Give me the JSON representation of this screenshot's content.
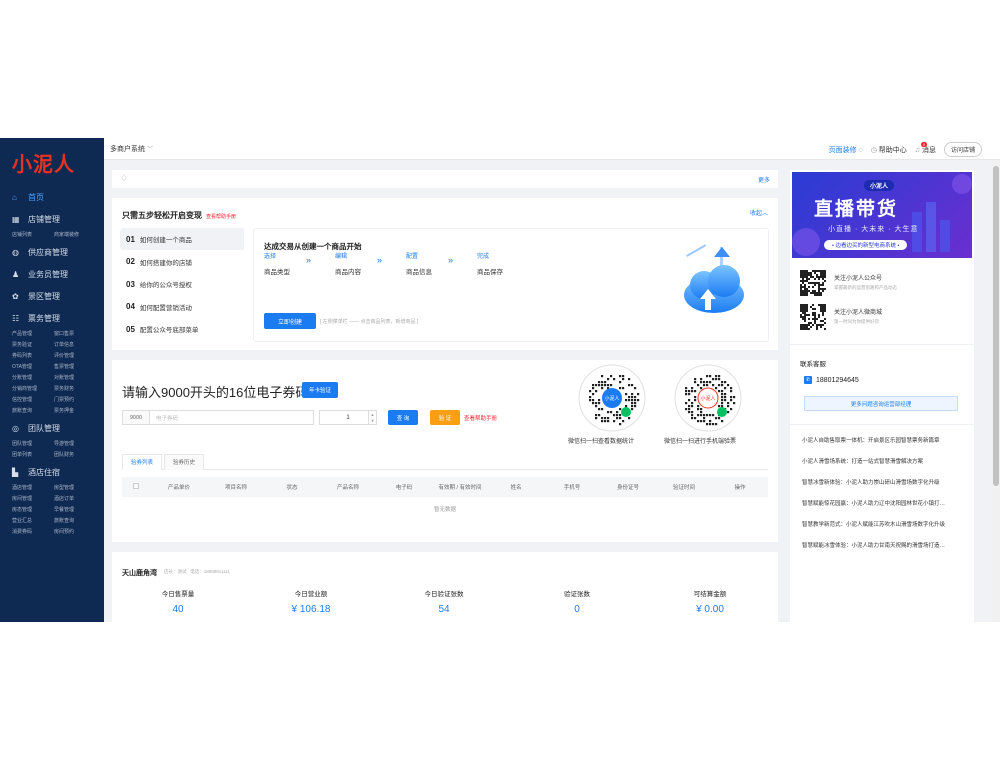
{
  "sidebar": {
    "logo_text": "小泥人",
    "groups": [
      {
        "icon": "home-icon",
        "glyph": "⌂",
        "label": "首页",
        "active": true,
        "subs": []
      },
      {
        "icon": "store-icon",
        "glyph": "▦",
        "label": "店铺管理",
        "active": false,
        "subs": [
          "店铺列表",
          "商家端装修"
        ]
      },
      {
        "icon": "supplier-icon",
        "glyph": "◍",
        "label": "供应商管理",
        "active": false,
        "subs": []
      },
      {
        "icon": "salesman-icon",
        "glyph": "♟",
        "label": "业务员管理",
        "active": false,
        "subs": []
      },
      {
        "icon": "scenic-icon",
        "glyph": "✿",
        "label": "景区管理",
        "active": false,
        "subs": []
      },
      {
        "icon": "ticket-icon",
        "glyph": "☷",
        "label": "票务管理",
        "active": false,
        "subs": [
          "产品管理",
          "窗口售票",
          "票务验证",
          "订单信息",
          "券码列表",
          "评价管理",
          "OTA管理",
          "售票管理",
          "分账管理",
          "对账管理",
          "分销商管理",
          "票务财务",
          "信控管理",
          "门票预约",
          "旅账查询",
          "票务押金"
        ]
      },
      {
        "icon": "team-icon",
        "glyph": "◎",
        "label": "团队管理",
        "active": false,
        "subs": [
          "团队管理",
          "导游管理",
          "团单列表",
          "团队财务"
        ]
      },
      {
        "icon": "hotel-icon",
        "glyph": "▙",
        "label": "酒店住宿",
        "active": false,
        "subs": [
          "酒店管理",
          "房型管理",
          "房间管理",
          "酒店订单",
          "房态管理",
          "早餐管理",
          "营业汇总",
          "旅账查询",
          "消费券码",
          "房间预约"
        ]
      }
    ]
  },
  "topbar": {
    "system": "多商户系统",
    "page_design": "页面装修",
    "help": "帮助中心",
    "messages": "消息",
    "message_count": "0",
    "visit": "访问店铺"
  },
  "notice": {
    "more": "更多"
  },
  "steps": {
    "title": "只需五步轻松开启变现",
    "help": "查看帮助手册",
    "collapse": "收起",
    "items": [
      {
        "num": "01",
        "label": "如何创建一个商品"
      },
      {
        "num": "02",
        "label": "如何搭建你的店铺"
      },
      {
        "num": "03",
        "label": "给你的公众号授权"
      },
      {
        "num": "04",
        "label": "如何配置营销活动"
      },
      {
        "num": "05",
        "label": "配置公众号底部菜单"
      }
    ],
    "panel_title": "达成交易从创建一个商品开始",
    "stages": [
      {
        "label": "选择",
        "value": "商品类型"
      },
      {
        "label": "编辑",
        "value": "商品内容"
      },
      {
        "label": "配置",
        "value": "商品信息"
      },
      {
        "label": "完成",
        "value": "商品保存"
      }
    ],
    "create_button": "立即创建",
    "hint": "[ 左侧菜单栏 —— 点击商品列表，新增商品 ]"
  },
  "coupon": {
    "title": "请输入9000开头的16位电子券码",
    "year_card": "年卡验证",
    "prefix": "9000",
    "code_placeholder": "电子券码",
    "qty": "1",
    "query": "查 询",
    "verify": "验 证",
    "help": "查看帮助手册",
    "qr_left_caption": "微信扫一扫查看数据统计",
    "qr_right_caption": "微信扫一扫进行手机端验票",
    "tabs": [
      "验券列表",
      "验券历史"
    ],
    "columns": [
      "",
      "产品单价",
      "项目名称",
      "状态",
      "产品名称",
      "电子码",
      "有效期 / 有效时间",
      "姓名",
      "手机号",
      "身份证号",
      "验证时间",
      "操作"
    ],
    "empty": "暂无数据"
  },
  "stats": {
    "shop": "天山鹿角湾",
    "role_label": "店长：",
    "role_value": "测试",
    "phone_label": "电话：",
    "phone_value": "18888811111",
    "items": [
      {
        "label": "今日售票量",
        "value": "40"
      },
      {
        "label": "今日营业额",
        "value": "¥ 106.18"
      },
      {
        "label": "今日验证张数",
        "value": "54"
      },
      {
        "label": "验证张数",
        "value": "0"
      },
      {
        "label": "可结算金额",
        "value": "¥ 0.00"
      }
    ]
  },
  "right": {
    "banner_tag": "小泥人",
    "banner_title": "直播带货",
    "banner_sub": "小直播 · 大未来 · 大生意",
    "banner_pill": "• 边看边买的新型电商系统 •",
    "follow": [
      {
        "title": "关注小泥人公众号",
        "sub": "掌握最新的运营思路和产品动态"
      },
      {
        "title": "关注小泥人微商城",
        "sub": "第一时间为你提供好货"
      }
    ],
    "contact_title": "联系客服",
    "phone": "18801294645",
    "consult": "更多问题咨询运营部经理",
    "news": [
      "小泥人自助售取票一体机：开启景区乐园智慧票务新篇章",
      "小泥人滑雪场系统：打造一站式智慧滑雪解决方案",
      "智慧冰雪新体验：小泥人助力崇山研山滑雪场数字化升级",
      "智慧赋能惊花园赢：小泥人助力辽中沈阳园林世花小镇打…",
      "智慧教学新范式：小泥人赋能江苏吹木山滑雪场数字化升级",
      "智慧赋能冰雪体验：小泥人助力甘南天祝赐的滑雪场打造…"
    ]
  }
}
